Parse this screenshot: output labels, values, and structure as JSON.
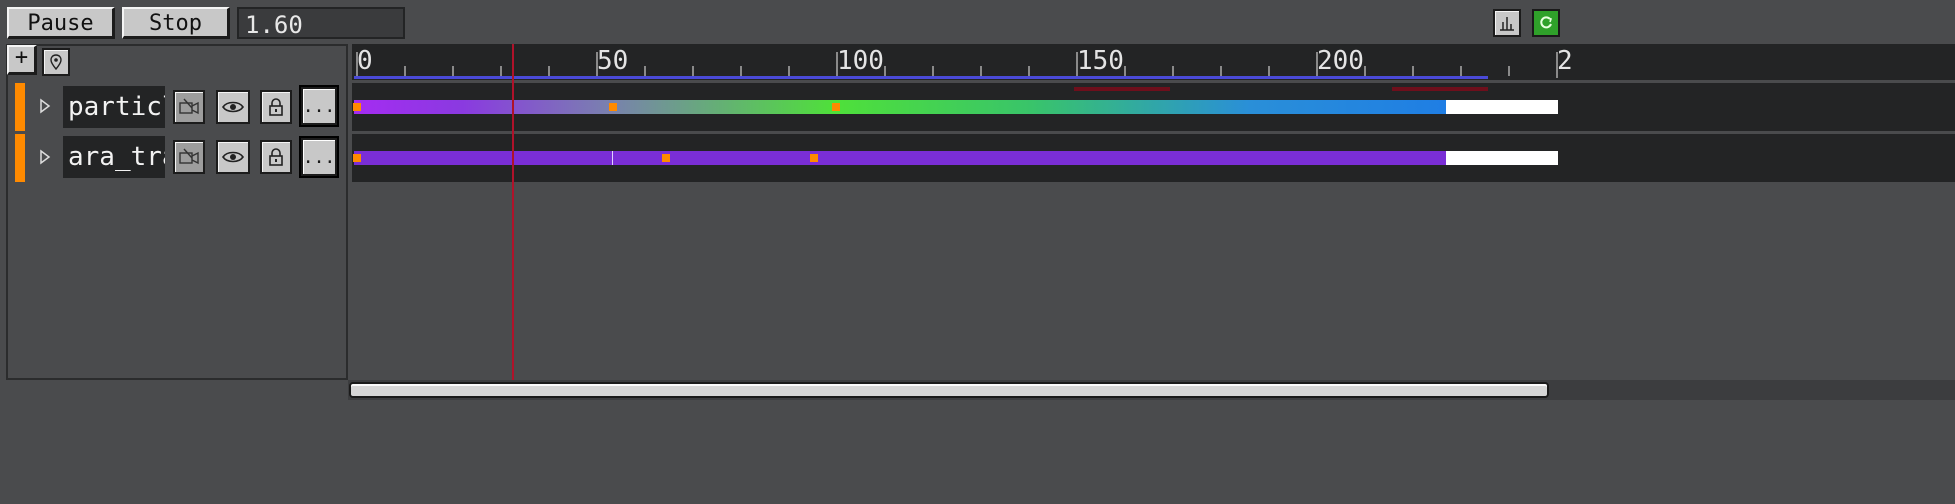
{
  "toolbar": {
    "pause_label": "Pause",
    "stop_label": "Stop",
    "time_value": "1.60"
  },
  "top_right": {
    "graph_icon": "curve-graph-icon",
    "sync_icon": "sync-icon"
  },
  "side_toolbar": {
    "add_label": "+",
    "marker_icon": "map-pin-icon"
  },
  "tracks": [
    {
      "name": "particle",
      "camera_icon": "camera-icon",
      "eye_icon": "eye-icon",
      "lock_icon": "lock-icon",
      "more_label": "..."
    },
    {
      "name": "ara_tra",
      "camera_icon": "camera-icon",
      "eye_icon": "eye-icon",
      "lock_icon": "lock-icon",
      "more_label": "..."
    }
  ],
  "ruler": {
    "labels": [
      "0",
      "50",
      "100",
      "150",
      "200",
      "2"
    ]
  },
  "colors": {
    "accent_orange": "#ff8a00",
    "playhead": "#b0122a",
    "track1_gradient": [
      "#a62cf0",
      "#55d63a",
      "#1f7fe0"
    ],
    "track2_color": "#7a2ed6"
  },
  "playhead_frame": 33
}
